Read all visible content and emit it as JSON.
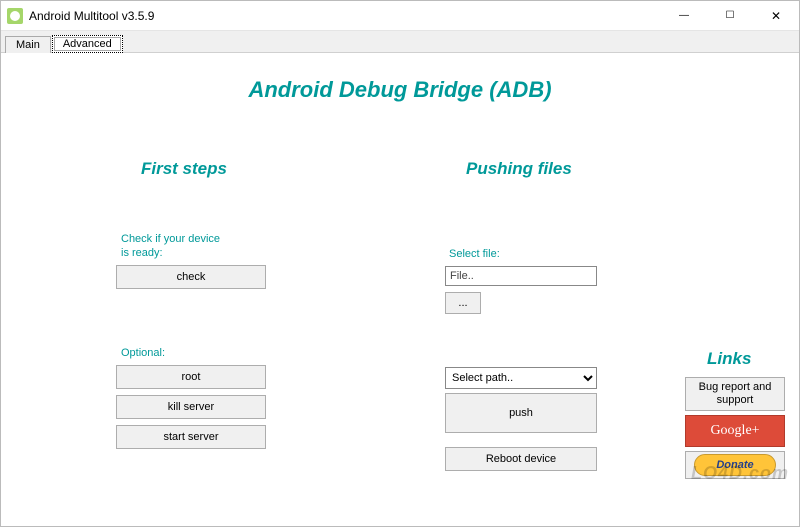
{
  "window": {
    "title": "Android Multitool v3.5.9",
    "minimize": "—",
    "maximize": "☐",
    "close": "✕"
  },
  "tabs": {
    "main": "Main",
    "advanced": "Advanced"
  },
  "heading": "Android Debug Bridge (ADB)",
  "first_steps": {
    "title": "First steps",
    "check_label": "Check if your device is ready:",
    "check_btn": "check",
    "optional_label": "Optional:",
    "root_btn": "root",
    "kill_btn": "kill server",
    "start_btn": "start server"
  },
  "pushing": {
    "title": "Pushing files",
    "select_file_label": "Select file:",
    "file_value": "File..",
    "browse_btn": "...",
    "path_select": "Select path..",
    "push_btn": "push",
    "reboot_btn": "Reboot device"
  },
  "links": {
    "title": "Links",
    "bug_btn": "Bug report and support",
    "gplus_btn": "Google+",
    "donate_btn": "Donate"
  },
  "watermark": "LO4D.com"
}
